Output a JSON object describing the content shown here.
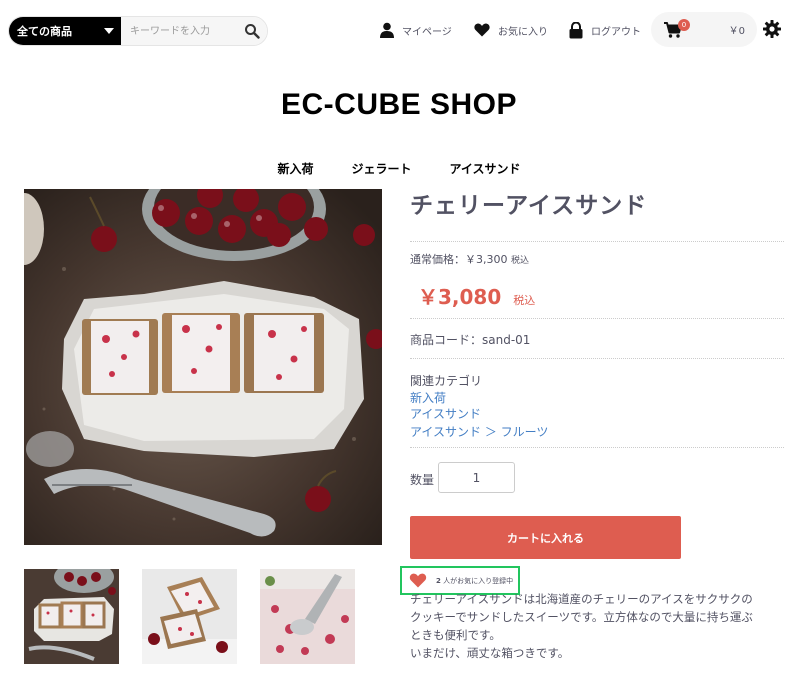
{
  "header": {
    "search_category": "全ての商品",
    "search_placeholder": "キーワードを入力",
    "nav": {
      "mypage": "マイページ",
      "favorites": "お気に入り",
      "logout": "ログアウト"
    },
    "cart": {
      "count": "0",
      "total": "￥0"
    }
  },
  "shop_title": "EC-CUBE SHOP",
  "categories": [
    "新入荷",
    "ジェラート",
    "アイスサンド"
  ],
  "product": {
    "name": "チェリーアイスサンド",
    "normal_price_label": "通常価格：￥3,300",
    "normal_price_tax": "税込",
    "sale_price": "￥3,080",
    "sale_tax": "税込",
    "code_label": "商品コード：",
    "code": "sand-01",
    "related_heading": "関連カテゴリ",
    "related": [
      "新入荷",
      "アイスサンド",
      "アイスサンド ＞ フルーツ"
    ],
    "quantity_label": "数量",
    "quantity": "1",
    "cart_button": "カートに入れる",
    "favorite_count": "2",
    "favorite_text": "人がお気に入り登録中",
    "description": [
      "チェリーアイスサンドは北海道産のチェリーのアイスをサクサクの",
      "クッキーでサンドしたスイーツです。立方体なので大量に持ち運ぶ",
      "ときも便利です。",
      "いまだけ、頑丈な箱つきです。"
    ]
  },
  "colors": {
    "accent": "#de5d50",
    "link": "#437ec4",
    "text": "#525263",
    "highlight": "#22c55e"
  }
}
